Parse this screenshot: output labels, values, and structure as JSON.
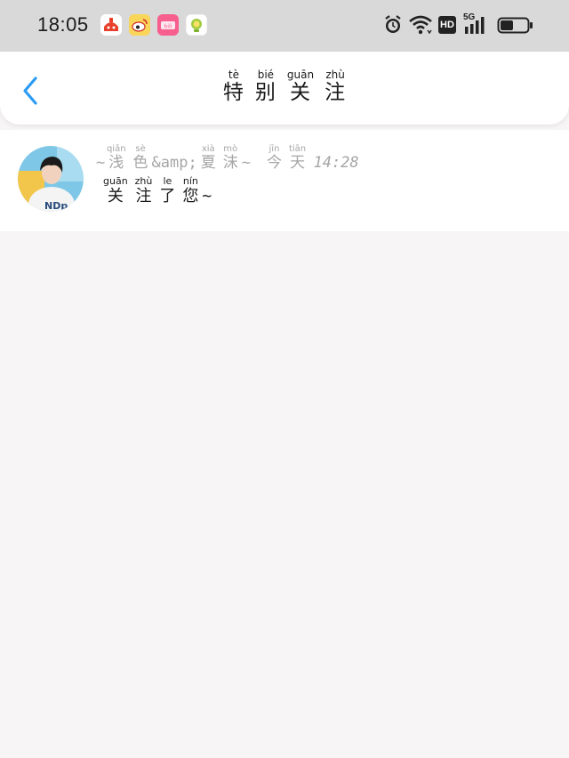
{
  "status_bar": {
    "time": "18:05",
    "hd_label": "HD",
    "network_label": "5G",
    "app_icons": [
      "music-app-icon",
      "weibo-icon",
      "photo-app-icon",
      "parenting-app-icon"
    ],
    "right_icons": [
      "alarm-icon",
      "wifi-icon",
      "hd-icon",
      "signal-5g-icon",
      "battery-icon"
    ]
  },
  "nav": {
    "title_chars": [
      {
        "char": "特",
        "pinyin": "tè"
      },
      {
        "char": "别",
        "pinyin": "bié"
      },
      {
        "char": "关",
        "pinyin": "guān"
      },
      {
        "char": "注",
        "pinyin": "zhù"
      }
    ]
  },
  "notifications": [
    {
      "sender_prefix": "~",
      "sender_chars": [
        {
          "char": "浅",
          "pinyin": "qiǎn"
        },
        {
          "char": "色",
          "pinyin": "sè"
        }
      ],
      "sender_middle": "&amp;",
      "sender_chars_2": [
        {
          "char": "夏",
          "pinyin": "xià"
        },
        {
          "char": "沫",
          "pinyin": "mò"
        }
      ],
      "sender_suffix": "~",
      "time_chars": [
        {
          "char": "今",
          "pinyin": "jīn"
        },
        {
          "char": "天",
          "pinyin": "tiān"
        }
      ],
      "time_value": "14:28",
      "message_chars": [
        {
          "char": "关",
          "pinyin": "guān"
        },
        {
          "char": "注",
          "pinyin": "zhù"
        },
        {
          "char": "了",
          "pinyin": "le"
        },
        {
          "char": "您",
          "pinyin": "nín"
        }
      ],
      "message_suffix": "~"
    }
  ],
  "colors": {
    "accent": "#2b9bf4",
    "status_bar_bg": "#d9d9d9",
    "page_bg": "#f7f5f6",
    "muted_text": "#a6a6a6"
  }
}
